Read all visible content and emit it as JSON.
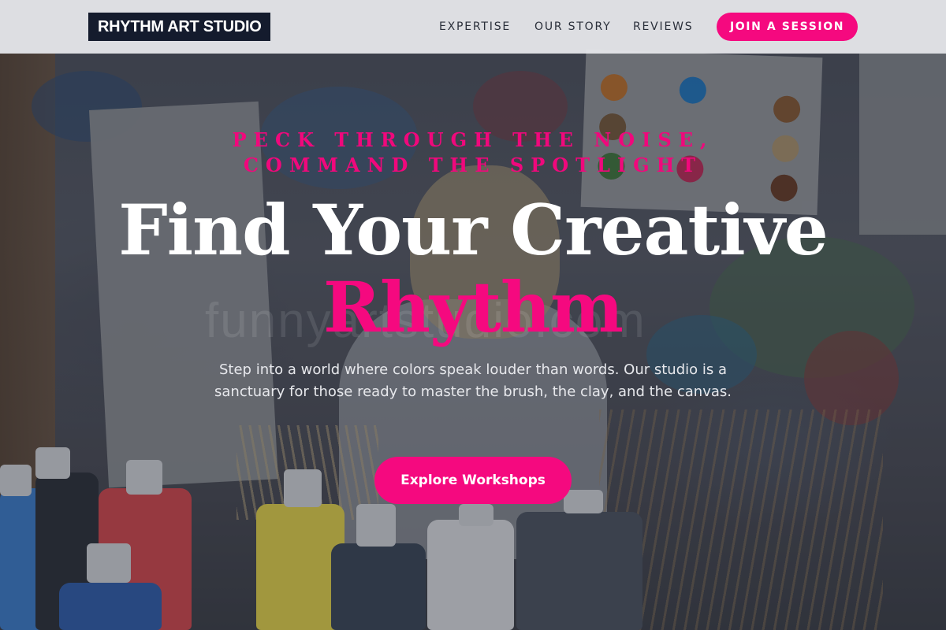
{
  "header": {
    "logo": "RHYTHM ART STUDIO",
    "nav": [
      {
        "label": "EXPERTISE"
      },
      {
        "label": "OUR STORY"
      },
      {
        "label": "REVIEWS"
      }
    ],
    "cta_label": "JOIN A SESSION"
  },
  "hero": {
    "tagline": "PECK THROUGH THE NOISE, COMMAND THE SPOTLIGHT",
    "title_line1": "Find Your Creative",
    "title_line2": "Rhythm",
    "description": "Step into a world where colors speak louder than words. Our studio is a sanctuary for those ready to master the brush, the clay, and the canvas.",
    "button_label": "Explore Workshops",
    "watermark": "funnyartstudio.com"
  },
  "colors": {
    "accent": "#f5097f",
    "header_bg": "#e8e9ec",
    "logo_bg": "#141b2d",
    "title_text": "#ffffff"
  }
}
